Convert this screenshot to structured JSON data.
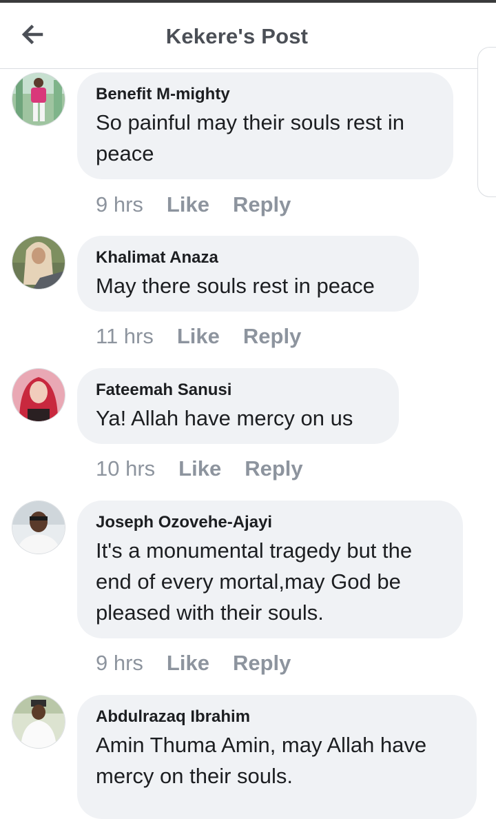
{
  "header": {
    "title": "Kekere's Post"
  },
  "comments": [
    {
      "author": "Benefit M-mighty",
      "text": "So painful may their souls rest in peace",
      "time": "9 hrs",
      "like_label": "Like",
      "reply_label": "Reply"
    },
    {
      "author": "Khalimat Anaza",
      "text": "May there souls rest in peace",
      "time": "11 hrs",
      "like_label": "Like",
      "reply_label": "Reply"
    },
    {
      "author": "Fateemah Sanusi",
      "text": "Ya! Allah have mercy on us",
      "time": "10 hrs",
      "like_label": "Like",
      "reply_label": "Reply"
    },
    {
      "author": "Joseph Ozovehe-Ajayi",
      "text": "It's a monumental tragedy but the end of every mortal,may God be pleased with their souls.",
      "time": "9 hrs",
      "like_label": "Like",
      "reply_label": "Reply"
    },
    {
      "author": "Abdulrazaq Ibrahim",
      "text": "Amin Thuma Amin, may Allah have mercy on their souls."
    }
  ],
  "colors": {
    "bubble": "#f0f2f5",
    "meta_text": "#8d949e",
    "title_text": "#4b4f56"
  }
}
